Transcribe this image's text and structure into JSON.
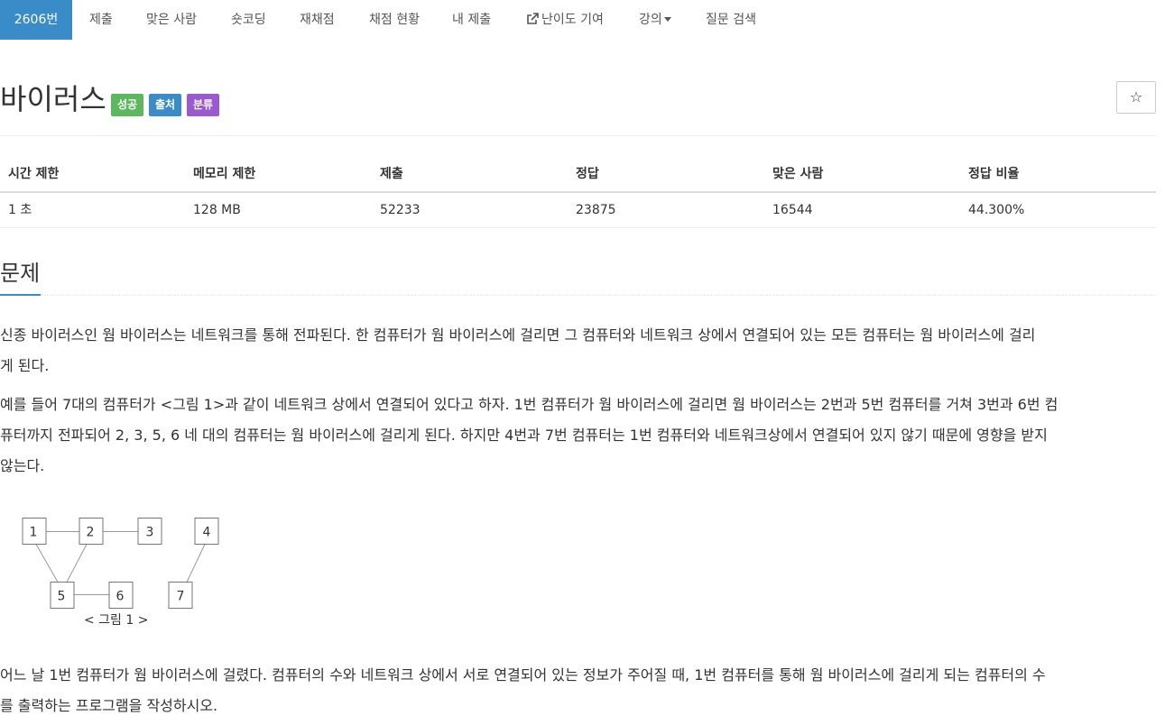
{
  "nav": {
    "active": "2606번",
    "items": [
      "제출",
      "맞은 사람",
      "숏코딩",
      "재채점",
      "채점 현황",
      "내 제출",
      "난이도 기여",
      "강의",
      "질문 검색"
    ]
  },
  "problem": {
    "title": "바이러스",
    "labels": [
      "성공",
      "출처",
      "분류"
    ],
    "star": "☆"
  },
  "info": {
    "headers": [
      "시간 제한",
      "메모리 제한",
      "제출",
      "정답",
      "맞은 사람",
      "정답 비율"
    ],
    "values": [
      "1 초",
      "128 MB",
      "52233",
      "23875",
      "16544",
      "44.300%"
    ]
  },
  "section": {
    "title": "문제",
    "p1_line1": "신종 바이러스인 웜 바이러스는 네트워크를 통해 전파된다. 한 컴퓨터가 웜 바이러스에 걸리면 그 컴퓨터와 네트워크 상에서 연결되어 있는 모든 컴퓨터는 웜 바이러스에 걸리",
    "p1_line2": "게 된다.",
    "p2_line1": "예를 들어 7대의 컴퓨터가 <그림 1>과 같이 네트워크 상에서 연결되어 있다고 하자. 1번 컴퓨터가 웜 바이러스에 걸리면 웜 바이러스는 2번과 5번 컴퓨터를 거쳐 3번과 6번 컴",
    "p2_line2": "퓨터까지 전파되어 2, 3, 5, 6 네 대의 컴퓨터는 웜 바이러스에 걸리게 된다. 하지만 4번과 7번 컴퓨터는 1번 컴퓨터와 네트워크상에서 연결되어 있지 않기 때문에 영향을 받지",
    "p2_line3": "않는다.",
    "figure_nodes": [
      "1",
      "2",
      "3",
      "4",
      "5",
      "6",
      "7"
    ],
    "figure_caption": "< 그림 1 >",
    "p3_line1": "어느 날 1번 컴퓨터가 웜 바이러스에 걸렸다. 컴퓨터의 수와 네트워크 상에서 서로 연결되어 있는 정보가 주어질 때, 1번 컴퓨터를 통해 웜 바이러스에 걸리게 되는 컴퓨터의 수",
    "p3_line2": "를 출력하는 프로그램을 작성하시오."
  },
  "colors": {
    "accent": "#3a8cc9",
    "success": "#5cb85c",
    "category": "#9b59d0"
  }
}
